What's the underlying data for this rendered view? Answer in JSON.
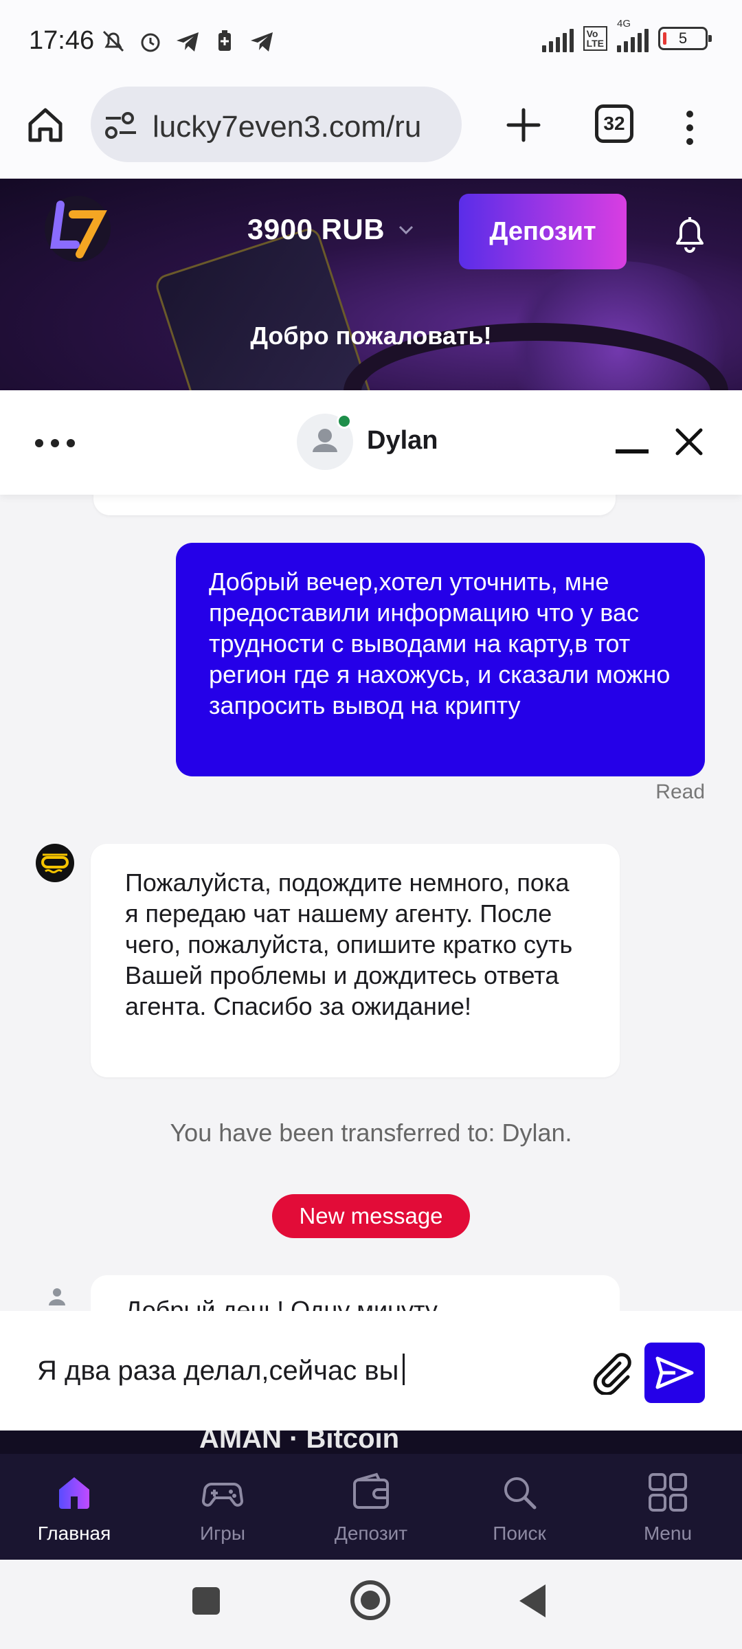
{
  "status_bar": {
    "time": "17:46",
    "network": "4G",
    "battery": "5"
  },
  "browser": {
    "url": "lucky7even3.com/ru",
    "tab_count": "32"
  },
  "site_header": {
    "balance": "3900 RUB",
    "deposit_label": "Депозит",
    "welcome": "Добро пожаловать!"
  },
  "chat": {
    "agent_name": "Dylan",
    "user_message": "Добрый вечер,хотел уточнить, мне предоставили информацию что у вас трудности с выводами на карту,в тот регион где я нахожусь, и сказали можно запросить вывод на крипту",
    "read_status": "Read",
    "bot_message": "Пожалуйста, подождите немного, пока я передаю чат нашему агенту. После чего, пожалуйста, опишите кратко суть Вашей проблемы и дождитесь ответа агента. Спасибо за ожидание!",
    "transfer_note": "You have been transferred to: Dylan.",
    "new_message_label": "New message",
    "next_message_partial": "Добрый день! Одну минуту",
    "input_value": "Я два раза делал,сейчас вы"
  },
  "strip_text": "AMAN · Bitcoin",
  "bottom_nav": [
    {
      "label": "Главная",
      "icon": "home-icon",
      "active": true
    },
    {
      "label": "Игры",
      "icon": "gamepad-icon",
      "active": false
    },
    {
      "label": "Депозит",
      "icon": "wallet-icon",
      "active": false
    },
    {
      "label": "Поиск",
      "icon": "search-icon",
      "active": false
    },
    {
      "label": "Menu",
      "icon": "grid-icon",
      "active": false
    }
  ],
  "colors": {
    "accent": "#2500e8",
    "new_message": "#e20c38",
    "online": "#1e8e4a",
    "deposit_gradient": [
      "#5a2de8",
      "#d93ee2"
    ]
  }
}
